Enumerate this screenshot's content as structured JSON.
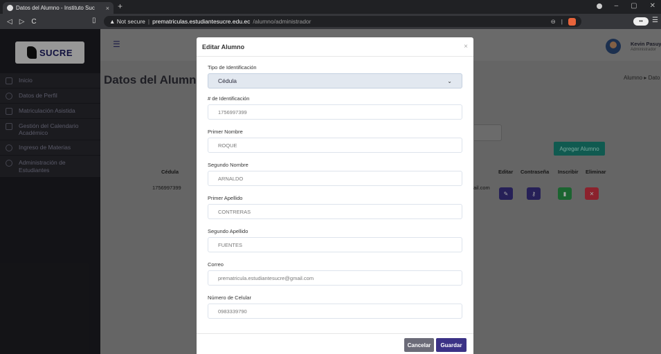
{
  "browser": {
    "tab_title": "Datos del Alumno - Instituto Suc",
    "tab_close": "×",
    "new_tab": "+",
    "not_secure": "▲ Not secure",
    "url_domain": "prematriculas.estudiantesucre.edu.ec",
    "url_path": "/alumno/administrador"
  },
  "sidebar": {
    "logo_text": "SUCRE",
    "items": [
      {
        "label": "Inicio",
        "icon": "grid-icon"
      },
      {
        "label": "Datos de Perfil",
        "icon": "user-icon"
      },
      {
        "label": "Matriculación Asistida",
        "icon": "badge-icon"
      },
      {
        "label": "Gestión del Calendario Académico",
        "icon": "calendar-icon"
      },
      {
        "label": "Ingreso de Materias",
        "icon": "gear-icon"
      },
      {
        "label": "Administración de Estudiantes",
        "icon": "user-icon"
      }
    ]
  },
  "header": {
    "user_name": "Kevin Pasuy",
    "user_role": "Administrador"
  },
  "page": {
    "title": "Datos del Alumno",
    "breadcrumb": "Alumno ▸ Dato",
    "add_button": "Agregar Alumno",
    "table": {
      "headers": [
        "Cédula",
        "Editar",
        "Contraseña",
        "Inscribir",
        "Eliminar"
      ],
      "row": {
        "cedula": "1756997399",
        "email_tail": "ail.com"
      }
    }
  },
  "modal": {
    "title": "Editar Alumno",
    "close": "×",
    "fields": [
      {
        "label": "Tipo de Identificación",
        "value": "Cédula"
      },
      {
        "label": "# de Identificación",
        "value": "1756997399"
      },
      {
        "label": "Primer Nombre",
        "value": "ROQUE"
      },
      {
        "label": "Segundo Nombre",
        "value": "ARNALDO"
      },
      {
        "label": "Primer Apellido",
        "value": "CONTRERAS"
      },
      {
        "label": "Segundo Apellido",
        "value": "FUENTES"
      },
      {
        "label": "Correo",
        "value": "prematricula.estudiantesucre@gmail.com"
      },
      {
        "label": "Número de Celular",
        "value": "0983339790"
      }
    ],
    "cancel": "Cancelar",
    "save": "Guardar"
  },
  "colors": {
    "sidebar_bg": "#1e1e24",
    "save_button": "#3b3286",
    "cancel_button": "#6b6b78",
    "add_button": "#1a8a7c",
    "edit_action": "#3b3286",
    "password_action": "#3b3286",
    "enroll_action": "#2a9a4a",
    "delete_action": "#d63545"
  }
}
